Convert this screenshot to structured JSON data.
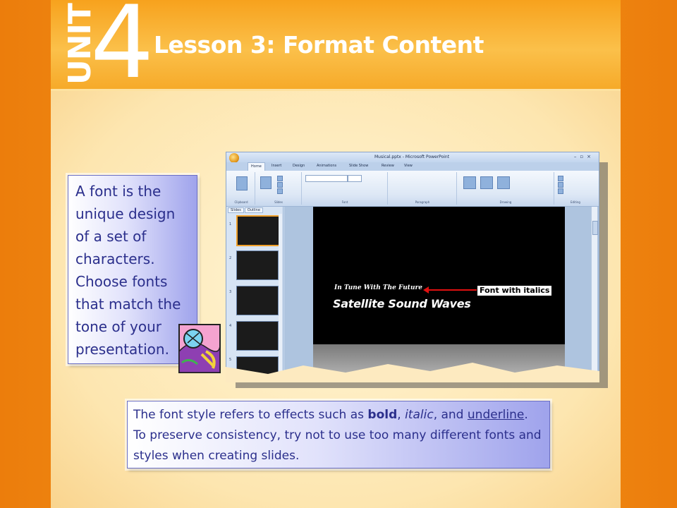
{
  "header": {
    "unit_word": "UNIT",
    "unit_number": "4",
    "lesson_title": "Lesson 3: Format Content"
  },
  "callout_left": {
    "text": "A font is the unique design of a set of characters. Choose fonts that match the tone of your presentation."
  },
  "callout_bottom": {
    "part1": "The font style refers to effects such as ",
    "bold_word": "bold",
    "sep1": ", ",
    "italic_word": "italic",
    "sep2": ", and ",
    "underline_word": "underline",
    "part2": ". To preserve consistency, try not to use too many different fonts and styles when creating slides."
  },
  "screenshot": {
    "window_title": "Musical.pptx - Microsoft PowerPoint",
    "tabs": [
      "Home",
      "Insert",
      "Design",
      "Animations",
      "Slide Show",
      "Review",
      "View"
    ],
    "ribbon_groups": [
      "Clipboard",
      "Slides",
      "Font",
      "Paragraph",
      "Drawing",
      "Editing"
    ],
    "panel_tabs": [
      "Slides",
      "Outline"
    ],
    "slide_numbers": [
      "1",
      "2",
      "3",
      "4",
      "5"
    ],
    "slide_subtitle": "In Tune With The Future",
    "slide_title": "Satellite Sound Waves",
    "callout_label": "Font with italics"
  },
  "colors": {
    "frame_orange": "#f08c12",
    "callout_text": "#2b2f8c",
    "arrow_red": "#e01010"
  }
}
